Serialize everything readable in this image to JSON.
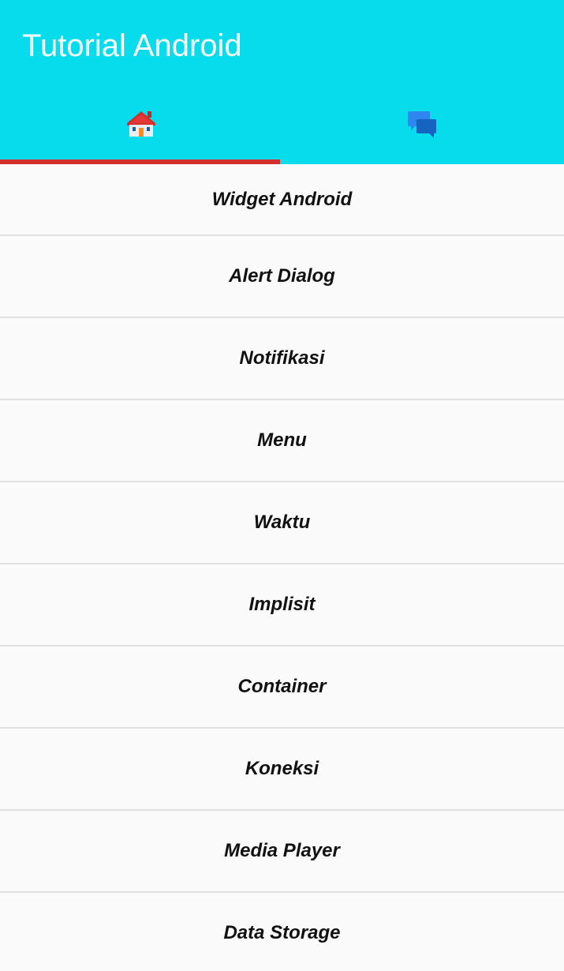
{
  "appbar": {
    "title": "Tutorial Android",
    "background_color": "#06dcec",
    "title_color": "#ffffff"
  },
  "tabs": [
    {
      "icon": "house-icon",
      "selected": true
    },
    {
      "icon": "chat-bubbles-icon",
      "selected": false
    }
  ],
  "tab_indicator_color": "#d32f2f",
  "menu": {
    "items": [
      {
        "label": "Widget Android"
      },
      {
        "label": "Alert Dialog"
      },
      {
        "label": "Notifikasi"
      },
      {
        "label": "Menu"
      },
      {
        "label": "Waktu"
      },
      {
        "label": "Implisit"
      },
      {
        "label": "Container"
      },
      {
        "label": "Koneksi"
      },
      {
        "label": "Media Player"
      },
      {
        "label": "Data Storage"
      }
    ]
  }
}
